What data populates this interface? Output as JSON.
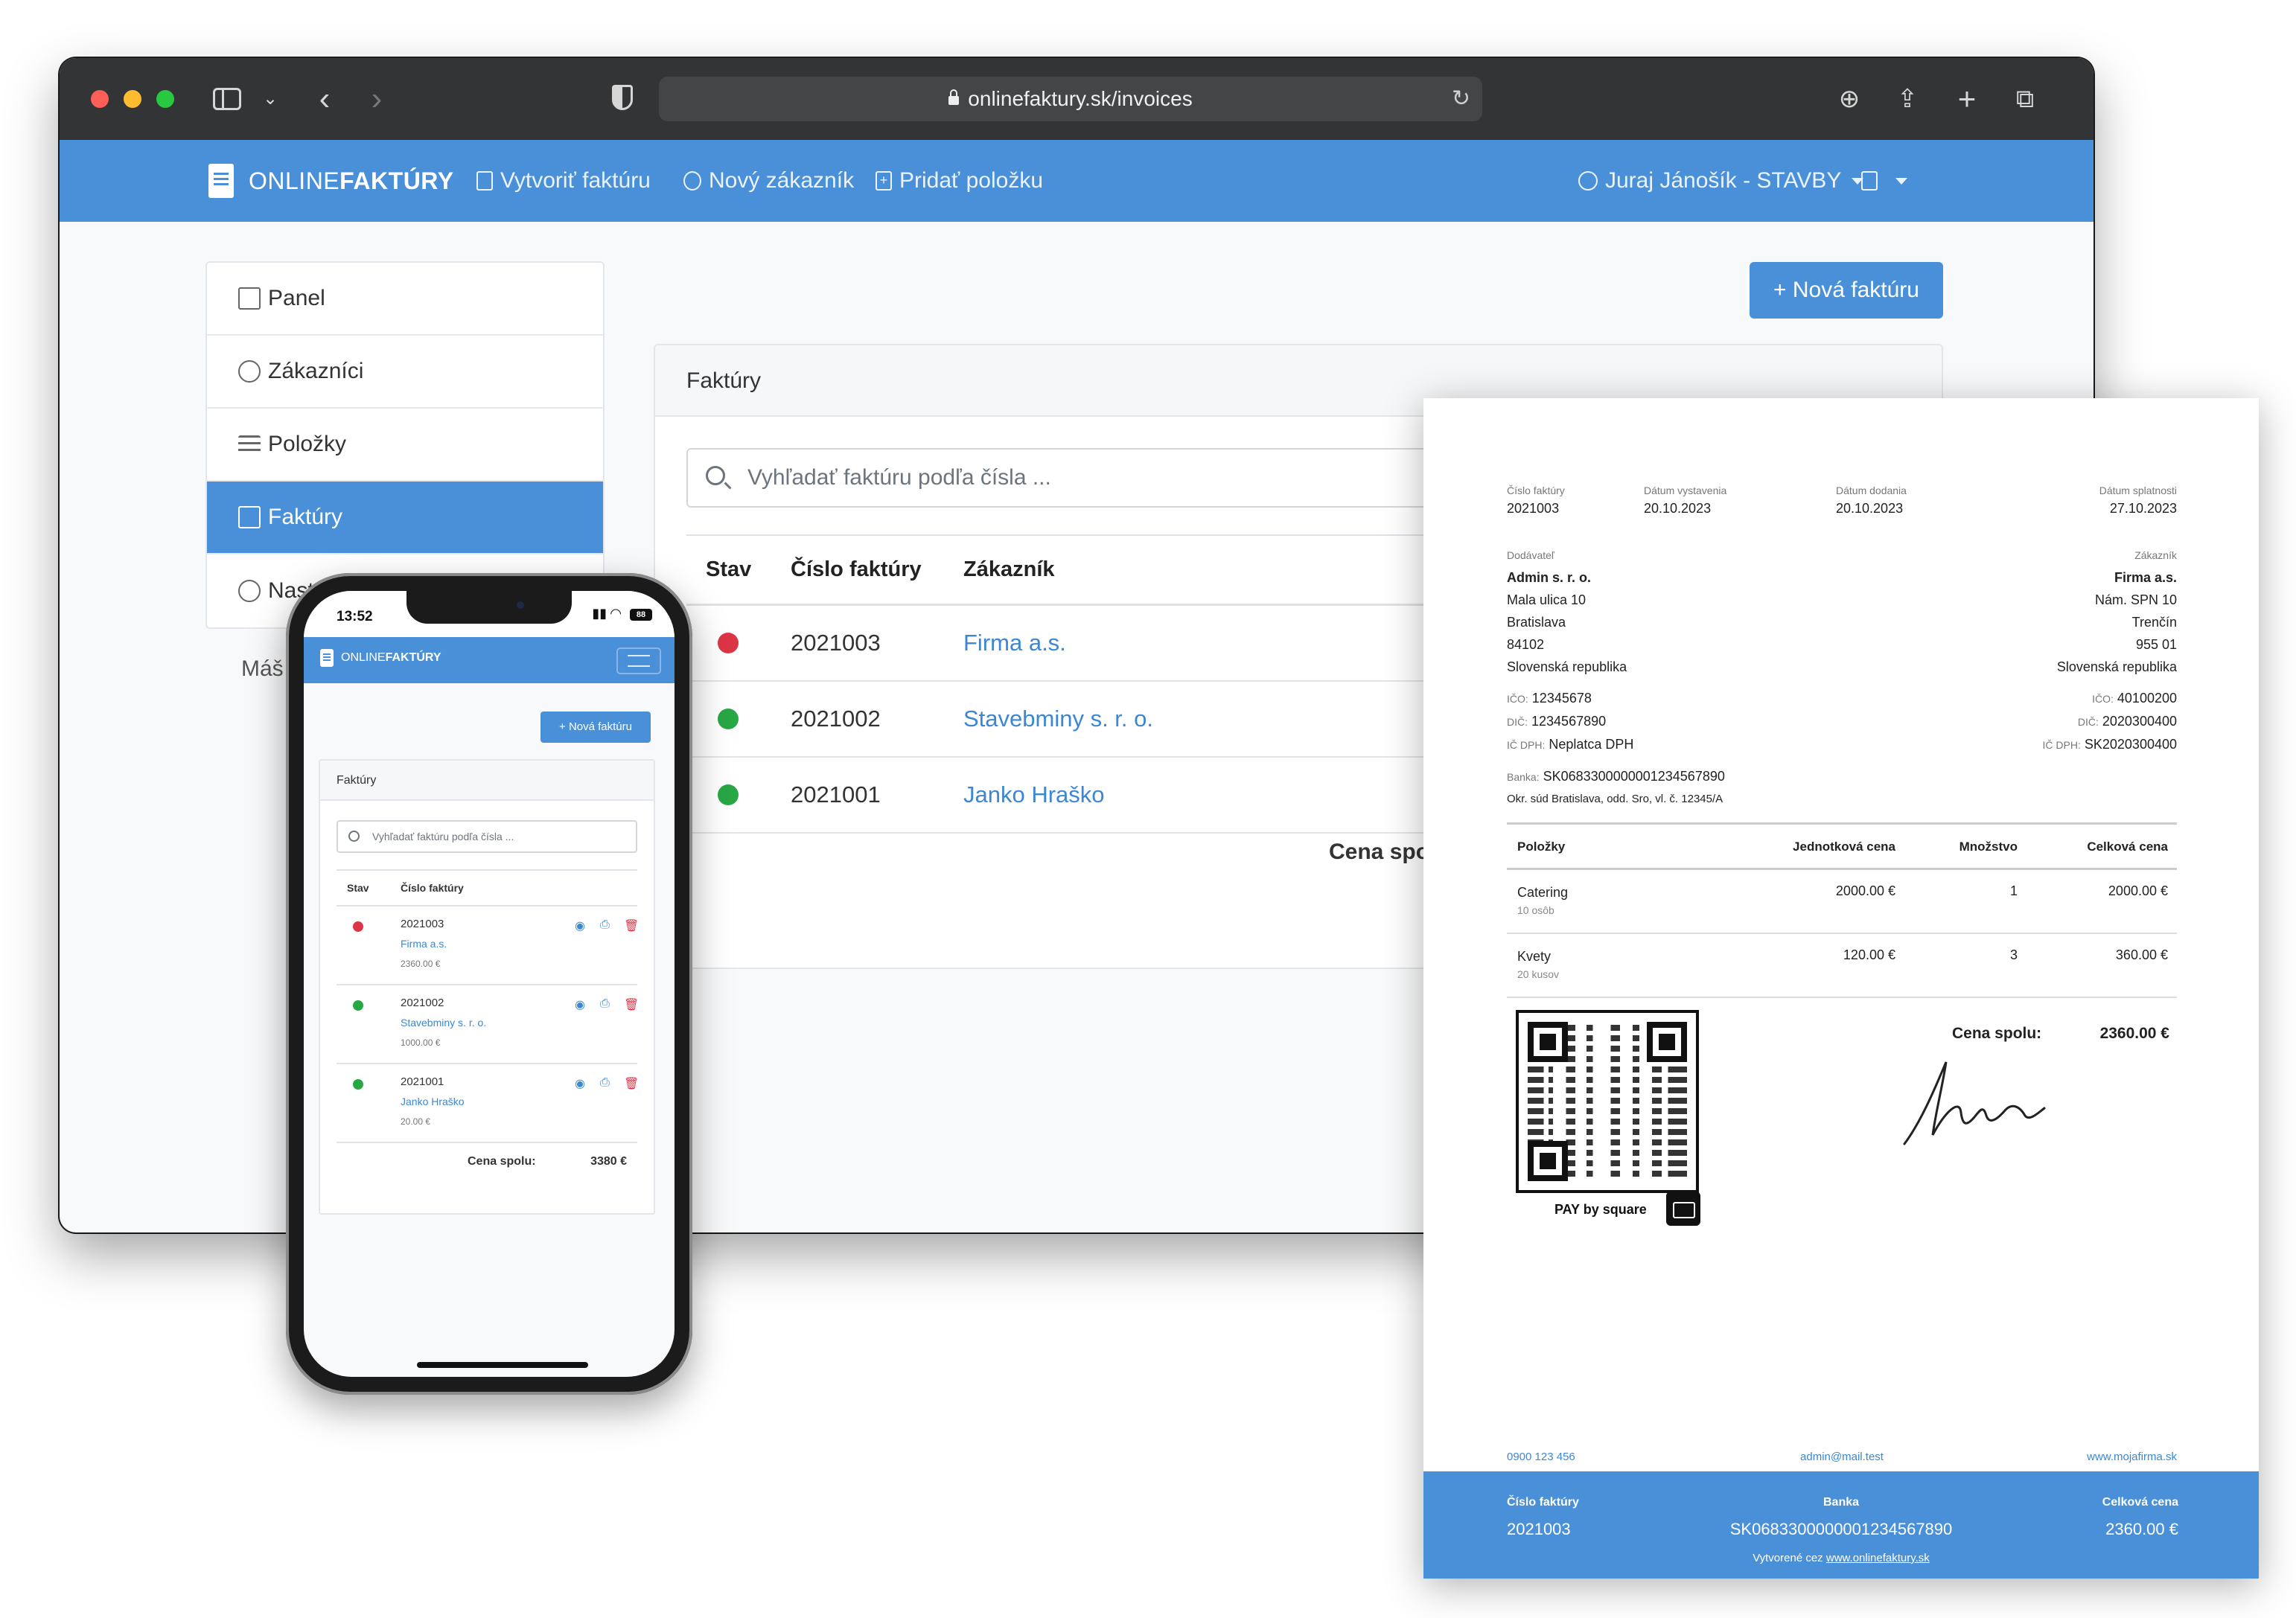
{
  "browser": {
    "url": "onlinefaktury.sk/invoices",
    "brand": {
      "light": "ONLINE",
      "bold": "FAKTÚRY"
    },
    "nav": {
      "create_invoice": "Vytvoriť faktúru",
      "new_customer": "Nový zákazník",
      "add_item": "Pridať položku",
      "user": "Juraj Jánošík - STAVBY"
    },
    "sidebar": {
      "items": [
        {
          "label": "Panel",
          "icon": "dashboard-icon"
        },
        {
          "label": "Zákazníci",
          "icon": "users-icon"
        },
        {
          "label": "Položky",
          "icon": "list-icon"
        },
        {
          "label": "Faktúry",
          "icon": "invoice-icon"
        },
        {
          "label": "Nast",
          "icon": "gear-icon"
        }
      ],
      "more": "Máš"
    },
    "new_invoice_button": "+ Nová faktúru",
    "card_title": "Faktúry",
    "search_placeholder": "Vyhľadať faktúru podľa čísla ...",
    "table": {
      "headers": [
        "Stav",
        "Číslo faktúry",
        "Zákazník"
      ],
      "rows": [
        {
          "status_color": "#dc3545",
          "number": "2021003",
          "customer": "Firma a.s."
        },
        {
          "status_color": "#28a745",
          "number": "2021002",
          "customer": "Stavebminy s. r. o."
        },
        {
          "status_color": "#28a745",
          "number": "2021001",
          "customer": "Janko Hraško"
        }
      ],
      "total_label": "Cena spolu"
    }
  },
  "phone": {
    "time": "13:52",
    "battery": "88",
    "brand": {
      "light": "ONLINE",
      "bold": "FAKTÚRY"
    },
    "new_invoice_button": "+ Nová faktúru",
    "card_title": "Faktúry",
    "search_placeholder": "Vyhľadať faktúru podľa čísla ...",
    "headers": [
      "Stav",
      "Číslo faktúry"
    ],
    "rows": [
      {
        "status_color": "#dc3545",
        "number": "2021003",
        "customer": "Firma a.s.",
        "amount": "2360.00 €"
      },
      {
        "status_color": "#28a745",
        "number": "2021002",
        "customer": "Stavebminy s. r. o.",
        "amount": "1000.00 €"
      },
      {
        "status_color": "#28a745",
        "number": "2021001",
        "customer": "Janko Hraško",
        "amount": "20.00 €"
      }
    ],
    "total_label": "Cena spolu:",
    "total_value": "3380 €"
  },
  "invoice": {
    "meta": [
      {
        "label": "Číslo faktúry",
        "value": "2021003"
      },
      {
        "label": "Dátum vystavenia",
        "value": "20.10.2023"
      },
      {
        "label": "Dátum dodania",
        "value": "20.10.2023"
      },
      {
        "label": "Dátum splatnosti",
        "value": "27.10.2023"
      }
    ],
    "supplier": {
      "heading": "Dodávateľ",
      "name": "Admin s. r. o.",
      "street": "Mala ulica 10",
      "city": "Bratislava",
      "zip": "84102",
      "country": "Slovenská republika",
      "ico_label": "IČO:",
      "ico": "12345678",
      "dic_label": "DIČ:",
      "dic": "1234567890",
      "icdph_label": "IČ DPH:",
      "icdph": "Neplatca DPH",
      "bank_label": "Banka:",
      "bank": "SK0683300000001234567890",
      "court": "Okr. súd Bratislava, odd. Sro, vl. č. 12345/A"
    },
    "customer": {
      "heading": "Zákazník",
      "name": "Firma a.s.",
      "street": "Nám. SPN 10",
      "city": "Trenčín",
      "zip": "955 01",
      "country": "Slovenská republika",
      "ico_label": "IČO:",
      "ico": "40100200",
      "dic_label": "DIČ:",
      "dic": "2020300400",
      "icdph_label": "IČ DPH:",
      "icdph": "SK2020300400"
    },
    "items_headers": [
      "Položky",
      "Jednotková cena",
      "Množstvo",
      "Celková cena"
    ],
    "items": [
      {
        "name": "Catering",
        "note": "10 osôb",
        "unit_price": "2000.00 €",
        "qty": "1",
        "total": "2000.00 €"
      },
      {
        "name": "Kvety",
        "note": "20 kusov",
        "unit_price": "120.00 €",
        "qty": "3",
        "total": "360.00 €"
      }
    ],
    "total_label": "Cena spolu:",
    "total_value": "2360.00 €",
    "pay_label": "PAY by square",
    "footer_links": {
      "phone": "0900 123 456",
      "email": "admin@mail.test",
      "web": "www.mojafirma.sk"
    },
    "band": {
      "number_label": "Číslo faktúry",
      "number": "2021003",
      "bank_label": "Banka",
      "bank": "SK0683300000001234567890",
      "total_label": "Celková cena",
      "total": "2360.00 €",
      "created_prefix": "Vytvorené cez",
      "created_link": "www.onlinefaktury.sk"
    }
  }
}
